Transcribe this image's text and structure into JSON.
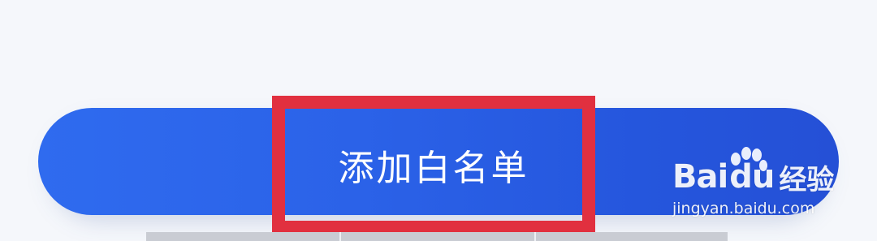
{
  "action_button": {
    "label": "添加白名单",
    "color": "#2b62e8"
  },
  "highlight": {
    "color": "#e1303f"
  },
  "watermark": {
    "brand_left": "Bai",
    "brand_right": "du",
    "product": "经验",
    "url": "jingyan.baidu.com"
  }
}
